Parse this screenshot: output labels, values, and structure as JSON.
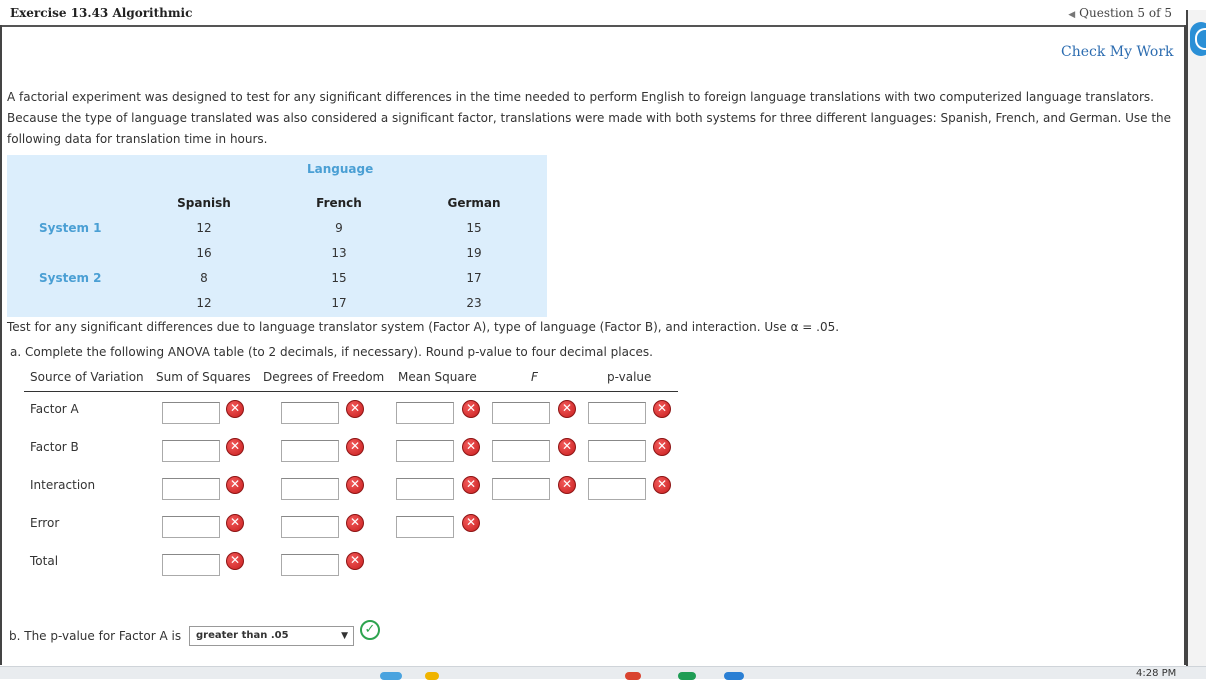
{
  "header": {
    "exercise_title": "Exercise 13.43 Algorithmic",
    "question_nav": "Question 5 of 5"
  },
  "check_my_work": "Check My Work",
  "problem_text": "A factorial experiment was designed to test for any significant differences in the time needed to perform English to foreign language translations with two computerized language translators. Because the type of language translated was also considered a significant factor, translations were made with both systems for three different languages: Spanish, French, and German. Use the following data for translation time in hours.",
  "data_table": {
    "group_label": "Language",
    "columns": [
      "Spanish",
      "French",
      "German"
    ],
    "rows": [
      {
        "label": "System 1",
        "values": [
          [
            "12",
            "9",
            "15"
          ],
          [
            "16",
            "13",
            "19"
          ]
        ]
      },
      {
        "label": "System 2",
        "values": [
          [
            "8",
            "15",
            "17"
          ],
          [
            "12",
            "17",
            "23"
          ]
        ]
      }
    ]
  },
  "test_text": "Test for any significant differences due to language translator system (Factor A), type of language (Factor B), and interaction. Use α = .05.",
  "part_a_text": "a. Complete the following ANOVA table (to 2 decimals, if necessary). Round p-value to four decimal places.",
  "anova": {
    "headers": [
      "Source of Variation",
      "Sum of Squares",
      "Degrees of Freedom",
      "Mean Square",
      "F",
      "p-value"
    ],
    "rows": [
      "Factor A",
      "Factor B",
      "Interaction",
      "Error",
      "Total"
    ],
    "status": "incorrect"
  },
  "part_b": {
    "prefix": "b. The p-value for Factor A is",
    "selected": "greater than .05",
    "status": "correct"
  },
  "system_clock": "4:28 PM",
  "colors": {
    "accent_blue": "#4a9fd4",
    "link_blue": "#2c6cb0",
    "data_bg": "#dceefc",
    "error_red": "#d32f2f",
    "ok_green": "#2ea44f"
  }
}
